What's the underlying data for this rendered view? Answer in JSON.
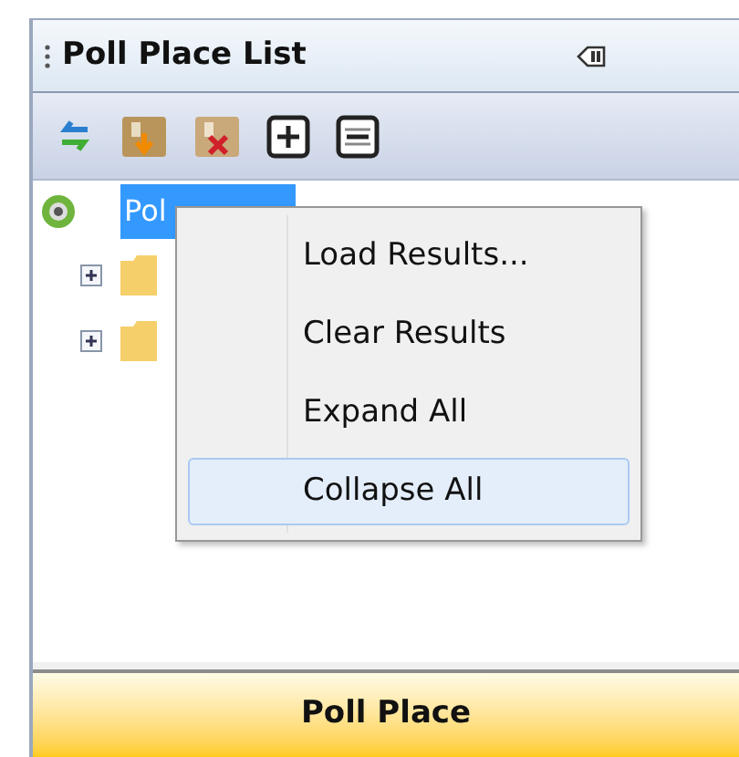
{
  "panel": {
    "title": "Poll Place List"
  },
  "tree": {
    "label": "Pol",
    "selected": true,
    "children": [
      {
        "expanded": false
      },
      {
        "expanded": false
      }
    ]
  },
  "context_menu": [
    {
      "label": "Load Results...",
      "selected": false
    },
    {
      "label": "Clear Results",
      "selected": false
    },
    {
      "label": "Expand All",
      "selected": false
    },
    {
      "label": "Collapse All",
      "selected": true
    }
  ],
  "bottom_tab": {
    "label": "Poll Place"
  }
}
